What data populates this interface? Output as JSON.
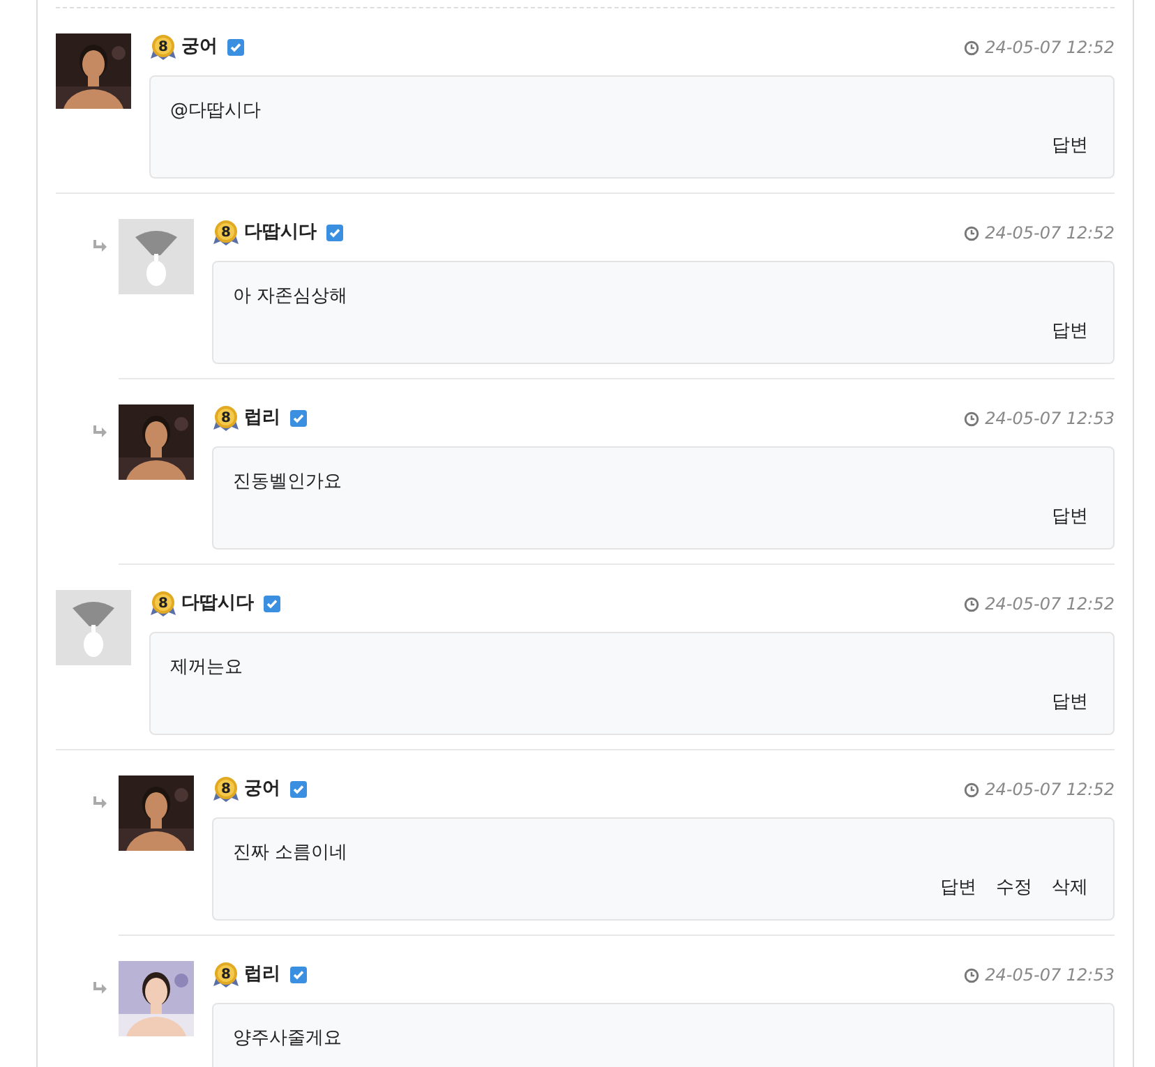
{
  "comments": [
    {
      "author": "궁어",
      "level_badge": "8",
      "verified": true,
      "reply": false,
      "time": "24-05-07 12:52",
      "text": "@다땁시다",
      "actions": [
        "답변"
      ]
    },
    {
      "author": "다땁시다",
      "level_badge": "8",
      "verified": true,
      "reply": true,
      "avatar": {
        "kind": "default"
      },
      "time": "24-05-07 12:52",
      "text": "아 자존심상해",
      "actions": [
        "답변"
      ]
    },
    {
      "author": "럽리",
      "level_badge": "8",
      "verified": true,
      "reply": true,
      "time": "24-05-07 12:53",
      "text": "진동벨인가요",
      "actions": [
        "답변"
      ]
    },
    {
      "author": "다땁시다",
      "level_badge": "8",
      "verified": true,
      "reply": false,
      "avatar": {
        "kind": "default"
      },
      "time": "24-05-07 12:52",
      "text": "제꺼는요",
      "actions": [
        "답변"
      ]
    },
    {
      "author": "궁어",
      "level_badge": "8",
      "verified": true,
      "reply": true,
      "time": "24-05-07 12:52",
      "text": "진짜 소름이네",
      "actions": [
        "답변",
        "수정",
        "삭제"
      ]
    },
    {
      "author": "럽리",
      "level_badge": "8",
      "verified": true,
      "reply": true,
      "time": "24-05-07 12:53",
      "text": "양주사줄게요"
    }
  ]
}
